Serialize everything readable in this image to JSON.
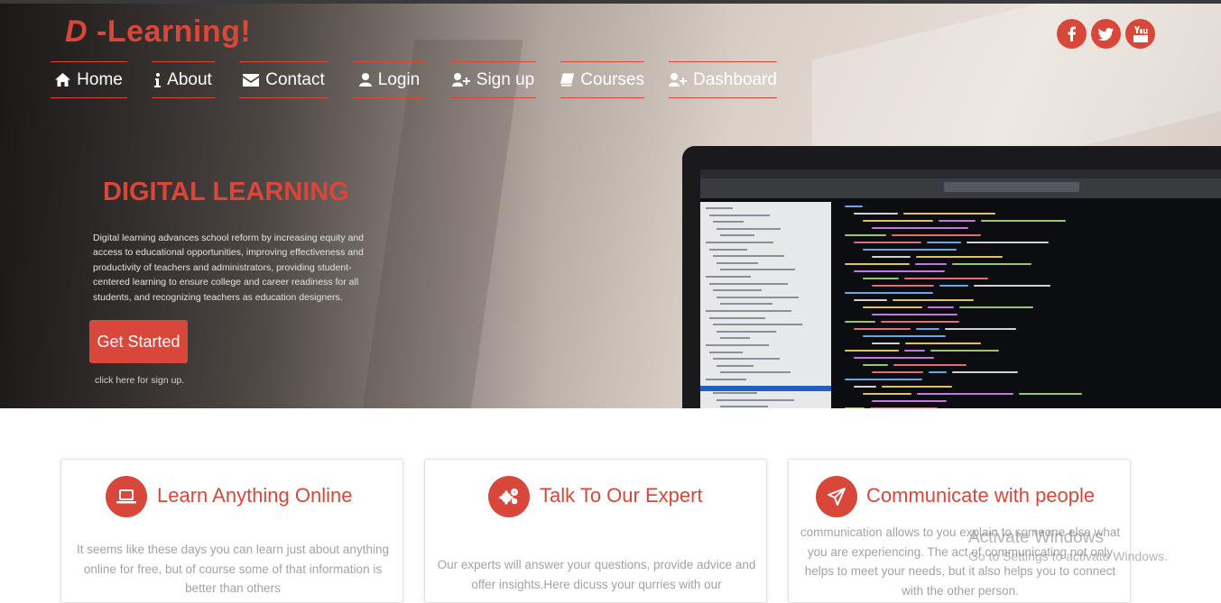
{
  "brand": {
    "prefix": "D",
    "rest": " -Learning!"
  },
  "nav": [
    {
      "label": "Home",
      "icon": "home-icon"
    },
    {
      "label": "About",
      "icon": "info-icon"
    },
    {
      "label": "Contact",
      "icon": "envelope-icon"
    },
    {
      "label": "Login",
      "icon": "user-icon"
    },
    {
      "label": "Sign up",
      "icon": "user-plus-icon"
    },
    {
      "label": "Courses",
      "icon": "book-icon"
    },
    {
      "label": "Dashboard",
      "icon": "user-plus-icon"
    }
  ],
  "social": [
    {
      "icon": "facebook-icon"
    },
    {
      "icon": "twitter-icon"
    },
    {
      "icon": "youtube-icon"
    }
  ],
  "hero": {
    "title": "DIGITAL LEARNING",
    "text": "Digital learning advances school reform by increasing equity and access to educational opportunities, improving effectiveness and productivity of teachers and administrators, providing student-centered learning to ensure college and career readiness for all students, and recognizing teachers as education designers.",
    "cta_label": "Get Started",
    "cta_hint": "click here for sign up."
  },
  "cards": [
    {
      "title": "Learn Anything Online",
      "icon": "laptop-icon",
      "text": "It seems like these days you can learn just about anything online for free, but of course some of that information is better than others"
    },
    {
      "title": "Talk To Our Expert",
      "icon": "cogs-icon",
      "text": "Our experts will answer your questions, provide advice and offer insights.Here dicuss your qurries with our"
    },
    {
      "title": "Communicate with people",
      "icon": "paper-plane-icon",
      "text": "communication allows to you explain to someone else what you are experiencing. The act of communicating not only helps to meet your needs, but it also helps you to connect with the other person."
    }
  ],
  "watermark": {
    "title": "Activate Windows",
    "subtitle": "Go to Settings to activate Windows."
  },
  "colors": {
    "accent": "#d9463a",
    "text_muted": "#a3a3a3"
  }
}
